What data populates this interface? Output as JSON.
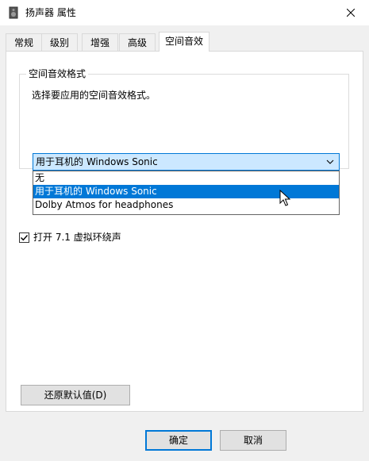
{
  "window": {
    "title": "扬声器 属性",
    "icon": "speaker-icon",
    "close_icon": "close-icon"
  },
  "tabs": [
    {
      "label": "常规",
      "active": false
    },
    {
      "label": "级别",
      "active": false
    },
    {
      "label": "增强",
      "active": false
    },
    {
      "label": "高级",
      "active": false
    },
    {
      "label": "空间音效",
      "active": true
    }
  ],
  "spatial": {
    "group_title": "空间音效格式",
    "description": "选择要应用的空间音效格式。",
    "selected_value": "用于耳机的 Windows Sonic",
    "options": [
      "无",
      "用于耳机的 Windows Sonic",
      "Dolby Atmos for headphones"
    ],
    "highlighted_index": 1
  },
  "virtual_surround": {
    "label": "打开 7.1 虚拟环绕声",
    "checked": true
  },
  "buttons": {
    "restore": "还原默认值(D)",
    "ok": "确定",
    "cancel": "取消"
  },
  "colors": {
    "accent": "#0078d7",
    "selection_bg": "#cce8ff"
  }
}
